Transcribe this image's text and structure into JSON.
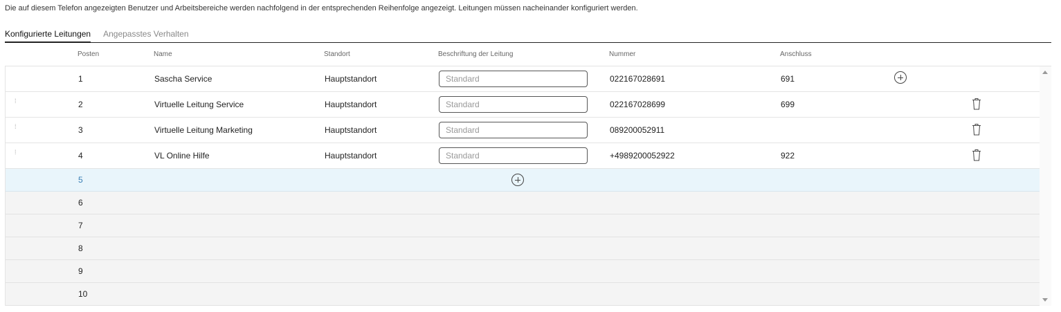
{
  "intro_text": "Die auf diesem Telefon angezeigten Benutzer und Arbeitsbereiche werden nachfolgend in der entsprechenden Reihenfolge angezeigt. Leitungen müssen nacheinander konfiguriert werden.",
  "tabs": [
    {
      "label": "Konfigurierte Leitungen",
      "active": true
    },
    {
      "label": "Angepasstes Verhalten",
      "active": false
    }
  ],
  "columns": {
    "posten": "Posten",
    "name": "Name",
    "standort": "Standort",
    "beschriftung": "Beschriftung der Leitung",
    "nummer": "Nummer",
    "anschluss": "Anschluss"
  },
  "field_placeholder": "Standard",
  "rows": [
    {
      "posten": "1",
      "name": "Sascha Service",
      "standort": "Hauptstandort",
      "label_value": "",
      "nummer": "022167028691",
      "anschluss": "691",
      "action_icon": "plus-circle-icon"
    },
    {
      "posten": "2",
      "name": "Virtuelle Leitung Service",
      "standort": "Hauptstandort",
      "label_value": "",
      "nummer": "022167028699",
      "anschluss": "699",
      "action_icon": "trash-icon"
    },
    {
      "posten": "3",
      "name": "Virtuelle Leitung Marketing",
      "standort": "Hauptstandort",
      "label_value": "",
      "nummer": "089200052911",
      "anschluss": "",
      "action_icon": "trash-icon"
    },
    {
      "posten": "4",
      "name": "VL Online Hilfe",
      "standort": "Hauptstandort",
      "label_value": "",
      "nummer": "+4989200052922",
      "anschluss": "922",
      "action_icon": "trash-icon"
    }
  ],
  "add_row": {
    "posten": "5",
    "icon": "plus-circle-icon"
  },
  "empty_rows": [
    "6",
    "7",
    "8",
    "9",
    "10"
  ],
  "colors": {
    "accent": "#3a7fb5",
    "add_row_bg": "#e9f5fb",
    "empty_row_bg": "#f4f4f4"
  }
}
